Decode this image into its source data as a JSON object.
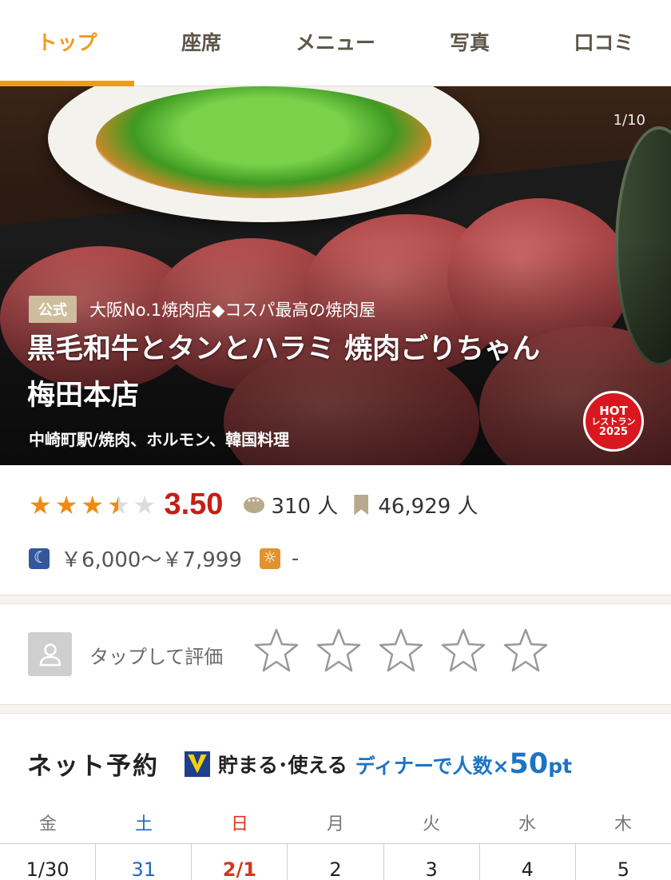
{
  "tabs": [
    {
      "label": "トップ",
      "active": true
    },
    {
      "label": "座席",
      "active": false
    },
    {
      "label": "メニュー",
      "active": false
    },
    {
      "label": "写真",
      "active": false
    },
    {
      "label": "口コミ",
      "active": false
    }
  ],
  "hero": {
    "photo_counter": "1/10",
    "official_badge": "公式",
    "catch_copy": "大阪No.1焼肉店◆コスパ最高の焼肉屋",
    "restaurant_name": "黒毛和牛とタンとハラミ 焼肉ごりちゃん 梅田本店",
    "genre": "中崎町駅/焼肉、ホルモン、韓国料理",
    "hot_badge": {
      "line1": "HOT",
      "line2": "レストラン",
      "line3": "2025"
    }
  },
  "rating": {
    "stars": 3.5,
    "score": "3.50",
    "reviews": "310 人",
    "bookmarks": "46,929 人",
    "dinner_price": "￥6,000～￥7,999",
    "lunch_price": "-"
  },
  "review_prompt": {
    "label": "タップして評価",
    "star_count": 5
  },
  "reservation": {
    "title": "ネット予約",
    "tpoint": "貯まる･使える",
    "promo": "ディナーで人数×",
    "promo_points": "50",
    "promo_unit": "pt",
    "weekdays": [
      "金",
      "土",
      "日",
      "月",
      "火",
      "水",
      "木"
    ],
    "dates": [
      "1/30",
      "31",
      "2/1",
      "2",
      "3",
      "4",
      "5"
    ]
  },
  "colors": {
    "accent": "#f39a12",
    "score_red": "#c61e17",
    "saturday_blue": "#1f68c3",
    "sunday_red": "#d6351d",
    "link_blue": "#1d74c6"
  }
}
